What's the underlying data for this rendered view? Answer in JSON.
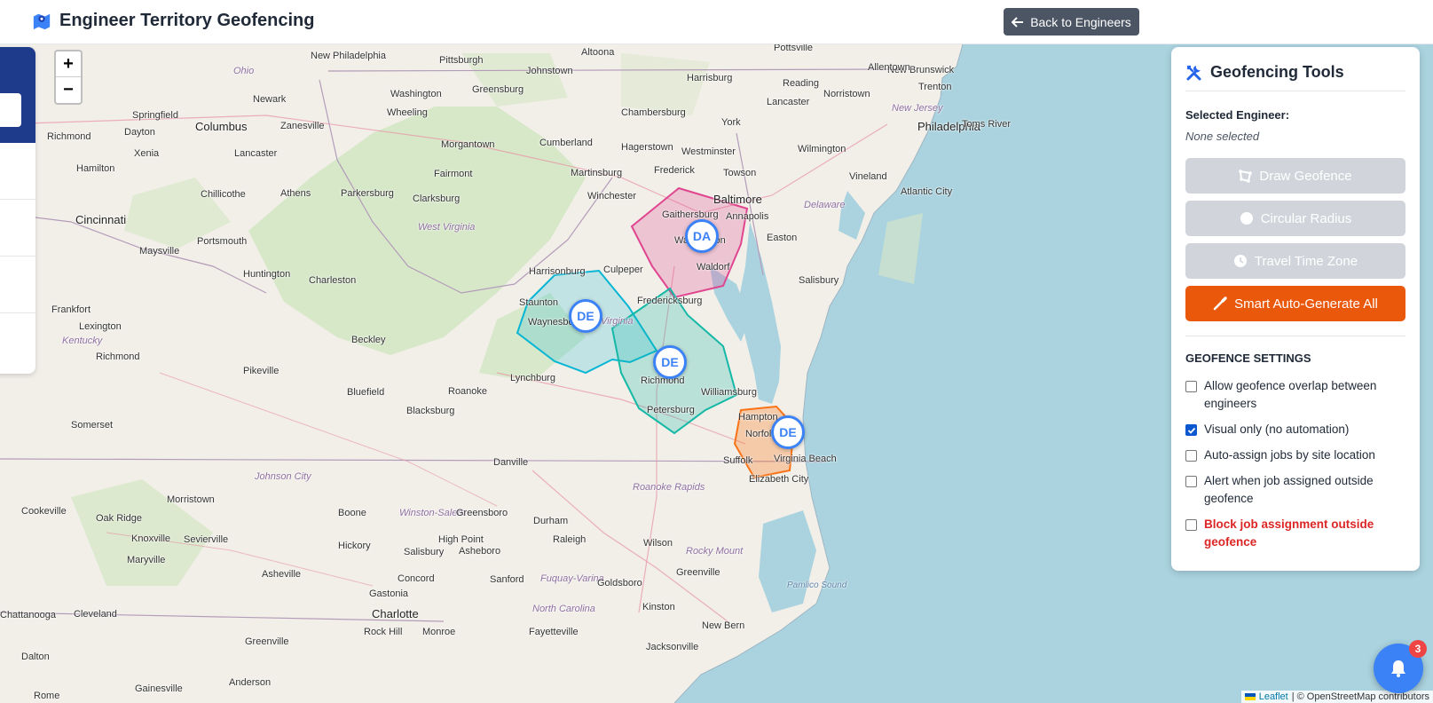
{
  "header": {
    "title": "Engineer Territory Geofencing",
    "back_button": "Back to Engineers"
  },
  "map": {
    "zoom_in": "+",
    "zoom_out": "−",
    "labels": [
      {
        "text": "Altoona"
      },
      {
        "text": "Pottsville"
      },
      {
        "text": "New Brunswick"
      },
      {
        "text": "New Philadelphia"
      },
      {
        "text": "Pittsburgh"
      },
      {
        "text": "Johnstown"
      },
      {
        "text": "Harrisburg"
      },
      {
        "text": "Allentown"
      },
      {
        "text": "Ohio"
      },
      {
        "text": "Washington"
      },
      {
        "text": "Greensburg"
      },
      {
        "text": "Reading"
      },
      {
        "text": "Norristown"
      },
      {
        "text": "Trenton"
      },
      {
        "text": "Newark"
      },
      {
        "text": "Wheeling"
      },
      {
        "text": "Lancaster"
      },
      {
        "text": "New Jersey"
      },
      {
        "text": "Springfield"
      },
      {
        "text": "Columbus"
      },
      {
        "text": "Zanesville"
      },
      {
        "text": "Chambersburg"
      },
      {
        "text": "York"
      },
      {
        "text": "Philadelphia"
      },
      {
        "text": "Toms River"
      },
      {
        "text": "Richmond"
      },
      {
        "text": "Dayton"
      },
      {
        "text": "Morgantown"
      },
      {
        "text": "Cumberland"
      },
      {
        "text": "Hagerstown"
      },
      {
        "text": "Westminster"
      },
      {
        "text": "Wilmington"
      },
      {
        "text": "Xenia"
      },
      {
        "text": "Lancaster"
      },
      {
        "text": "Hamilton"
      },
      {
        "text": "Fairmont"
      },
      {
        "text": "Martinsburg"
      },
      {
        "text": "Frederick"
      },
      {
        "text": "Towson"
      },
      {
        "text": "Vineland"
      },
      {
        "text": "Chillicothe"
      },
      {
        "text": "Athens"
      },
      {
        "text": "Parkersburg"
      },
      {
        "text": "Clarksburg"
      },
      {
        "text": "Winchester"
      },
      {
        "text": "Baltimore"
      },
      {
        "text": "Delaware"
      },
      {
        "text": "Atlantic City"
      },
      {
        "text": "Cincinnati"
      },
      {
        "text": "Gaithersburg"
      },
      {
        "text": "Annapolis"
      },
      {
        "text": "West Virginia"
      },
      {
        "text": "Easton"
      },
      {
        "text": "Maysville"
      },
      {
        "text": "Portsmouth"
      },
      {
        "text": "Washington"
      },
      {
        "text": "Huntington"
      },
      {
        "text": "Charleston"
      },
      {
        "text": "Waldorf"
      },
      {
        "text": "Harrisonburg"
      },
      {
        "text": "Culpeper"
      },
      {
        "text": "Salisbury"
      },
      {
        "text": "Frankfort"
      },
      {
        "text": "Staunton"
      },
      {
        "text": "Fredericksburg"
      },
      {
        "text": "Lexington"
      },
      {
        "text": "Waynesboro"
      },
      {
        "text": "Virginia"
      },
      {
        "text": "Kentucky"
      },
      {
        "text": "Beckley"
      },
      {
        "text": "Richmond"
      },
      {
        "text": "Pikeville"
      },
      {
        "text": "Lynchburg"
      },
      {
        "text": "Richmond"
      },
      {
        "text": "Williamsburg"
      },
      {
        "text": "Bluefield"
      },
      {
        "text": "Roanoke"
      },
      {
        "text": "Blacksburg"
      },
      {
        "text": "Petersburg"
      },
      {
        "text": "Hampton"
      },
      {
        "text": "Somerset"
      },
      {
        "text": "Norfolk"
      },
      {
        "text": "Virginia Beach"
      },
      {
        "text": "Danville"
      },
      {
        "text": "Suffolk"
      },
      {
        "text": "Elizabeth City"
      },
      {
        "text": "Johnson City"
      },
      {
        "text": "Roanoke Rapids"
      },
      {
        "text": "Morristown"
      },
      {
        "text": "Cookeville"
      },
      {
        "text": "Oak Ridge"
      },
      {
        "text": "Boone"
      },
      {
        "text": "Winston-Salem"
      },
      {
        "text": "Greensboro"
      },
      {
        "text": "Durham"
      },
      {
        "text": "Knoxville"
      },
      {
        "text": "Sevierville"
      },
      {
        "text": "High Point"
      },
      {
        "text": "Raleigh"
      },
      {
        "text": "Maryville"
      },
      {
        "text": "Hickory"
      },
      {
        "text": "Salisbury"
      },
      {
        "text": "Asheboro"
      },
      {
        "text": "Wilson"
      },
      {
        "text": "Rocky Mount"
      },
      {
        "text": "Greenville"
      },
      {
        "text": "Asheville"
      },
      {
        "text": "Concord"
      },
      {
        "text": "Sanford"
      },
      {
        "text": "Fuquay-Varina"
      },
      {
        "text": "Goldsboro"
      },
      {
        "text": "Pamlico Sound"
      },
      {
        "text": "Gastonia"
      },
      {
        "text": "Charlotte"
      },
      {
        "text": "North Carolina"
      },
      {
        "text": "Kinston"
      },
      {
        "text": "Chattanooga"
      },
      {
        "text": "Cleveland"
      },
      {
        "text": "Rock Hill"
      },
      {
        "text": "Monroe"
      },
      {
        "text": "New Bern"
      },
      {
        "text": "Fayetteville"
      },
      {
        "text": "Greenville"
      },
      {
        "text": "Jacksonville"
      },
      {
        "text": "Dalton"
      },
      {
        "text": "Anderson"
      },
      {
        "text": "Rome"
      },
      {
        "text": "Gainesville"
      }
    ],
    "markers": [
      {
        "text": "DA"
      },
      {
        "text": "DE"
      },
      {
        "text": "DE"
      },
      {
        "text": "DE"
      }
    ],
    "attribution": {
      "leaflet": "Leaflet",
      "osm": "| © OpenStreetMap contributors"
    }
  },
  "tools": {
    "title": "Geofencing Tools",
    "selected_label": "Selected Engineer:",
    "selected_value": "None selected",
    "buttons": {
      "draw": "Draw Geofence",
      "radius": "Circular Radius",
      "travel": "Travel Time Zone",
      "auto": "Smart Auto-Generate All"
    },
    "settings_title": "GEOFENCE SETTINGS",
    "options": [
      {
        "label": "Allow geofence overlap between engineers",
        "checked": false
      },
      {
        "label": "Visual only (no automation)",
        "checked": true
      },
      {
        "label": "Auto-assign jobs by site location",
        "checked": false
      },
      {
        "label": "Alert when job assigned outside geofence",
        "checked": false
      },
      {
        "label": "Block job assignment outside geofence",
        "checked": false
      }
    ]
  },
  "notifications": {
    "count": "3"
  },
  "colors": {
    "accent": "#ea580c",
    "marker": "#3b82f6",
    "zone_pink": "#e0458f",
    "zone_teal": "#14b8a6",
    "zone_cyan": "#06b6d4",
    "zone_orange": "#f97316"
  }
}
